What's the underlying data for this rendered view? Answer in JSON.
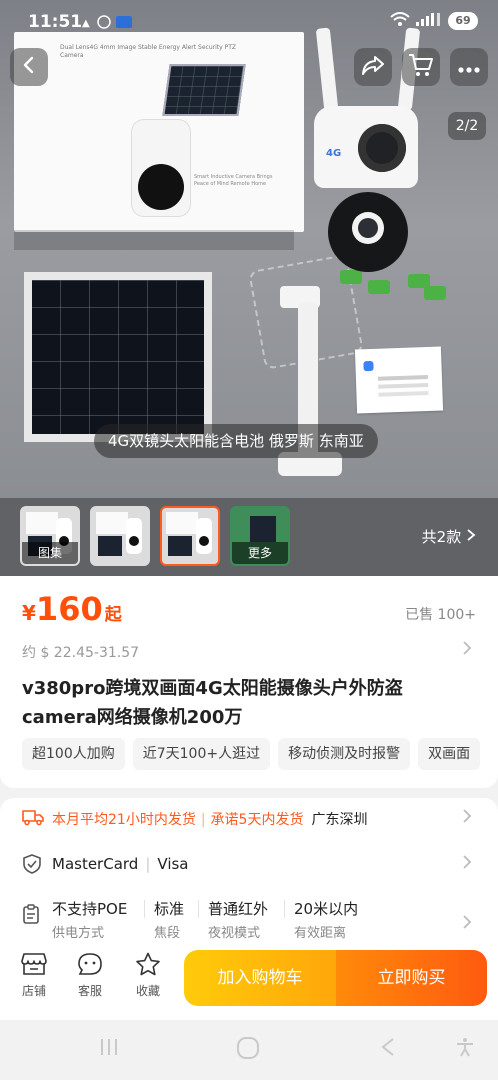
{
  "status_bar": {
    "time": "11:51",
    "signal_icons": "📶",
    "battery": "69"
  },
  "gallery": {
    "caption": "4G双镜头太阳能含电池 俄罗斯 东南亚",
    "pager": "2/2",
    "box_text": "Dual Lens4G 4mm Image Stable Energy Alert Security PTZ Camera",
    "box_text2": "Smart Inductive Camera Brings Peace of Mind Remote Home",
    "cam_label": "4G"
  },
  "thumbnails": {
    "items": [
      {
        "label": "图集",
        "selected": false
      },
      {
        "label": "",
        "selected": false
      },
      {
        "label": "",
        "selected": true
      },
      {
        "label": "更多",
        "selected": false
      }
    ],
    "total": "共2款"
  },
  "price": {
    "currency": "¥",
    "amount": "160",
    "suffix": "起",
    "sold": "已售 100+",
    "usd": "约 $ 22.45-31.57"
  },
  "product": {
    "title": "v380pro跨境双画面4G太阳能摄像头户外防盗camera网络摄像机200万",
    "tags": [
      "超100人加购",
      "近7天100+人逛过",
      "移动侦测及时报警",
      "双画面"
    ]
  },
  "shipping": {
    "promise1": "本月平均21小时内发货",
    "promise2": "承诺5天内发货",
    "location": "广东深圳"
  },
  "payment": {
    "methods": [
      "MasterCard",
      "Visa"
    ]
  },
  "specs": {
    "values": [
      "不支持POE",
      "标准",
      "普通红外",
      "20米以内"
    ],
    "keys": [
      "供电方式",
      "焦段",
      "夜视模式",
      "有效距离"
    ]
  },
  "bottom_bar": {
    "shop": "店铺",
    "service": "客服",
    "favorite": "收藏",
    "add_to_cart": "加入购物车",
    "buy_now": "立即购买"
  },
  "colors": {
    "accent": "#ff4f0a",
    "cart_button": "#ffb30a",
    "buy_button": "#ff6a10"
  }
}
